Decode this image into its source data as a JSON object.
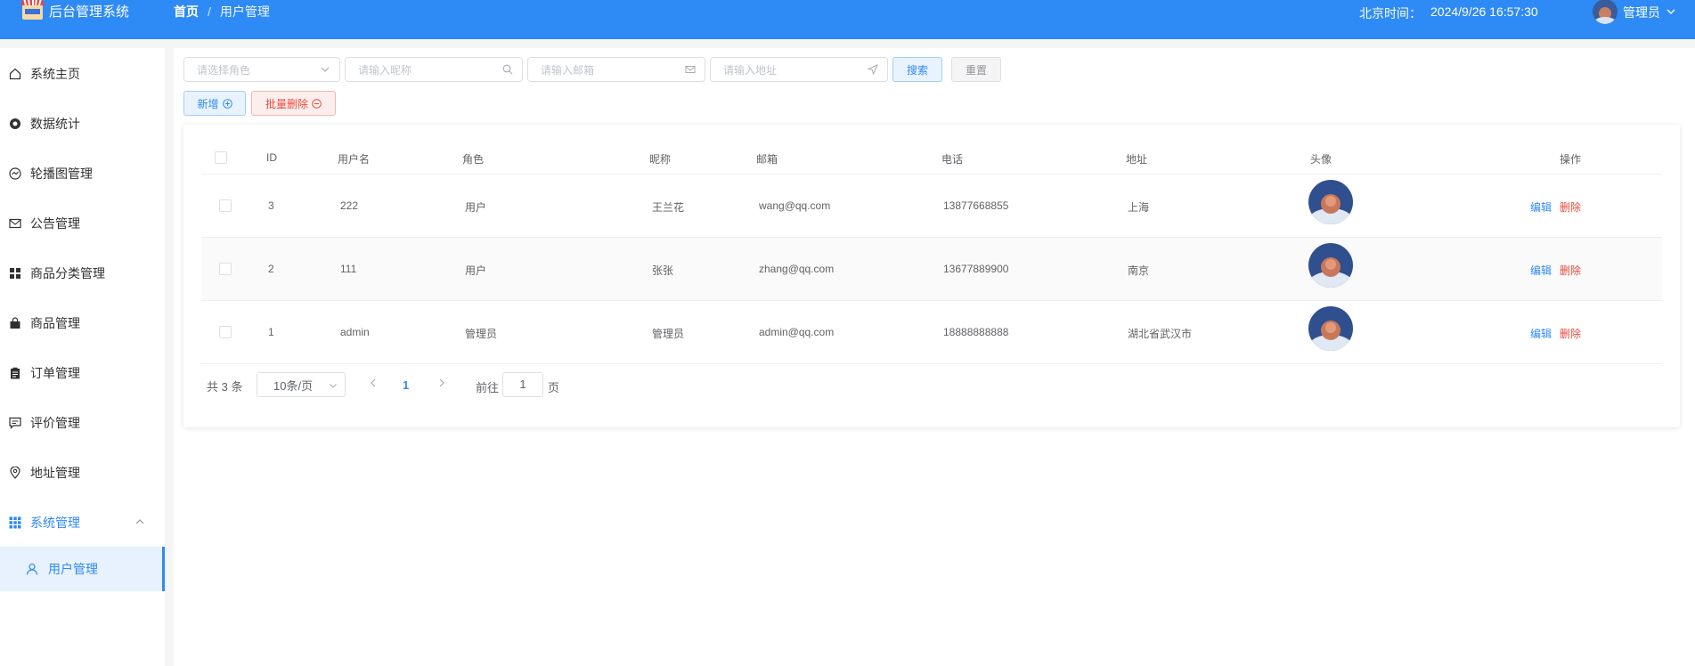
{
  "app": {
    "title": "后台管理系统"
  },
  "breadcrumb": {
    "home": "首页",
    "separator": "/",
    "current": "用户管理"
  },
  "clock": {
    "label": "北京时间：",
    "value": "2024/9/26 16:57:30"
  },
  "user": {
    "name": "管理员"
  },
  "sidebar": {
    "items": [
      {
        "label": "系统主页",
        "icon": "home-icon"
      },
      {
        "label": "数据统计",
        "icon": "stats-icon"
      },
      {
        "label": "轮播图管理",
        "icon": "carousel-icon"
      },
      {
        "label": "公告管理",
        "icon": "mail-icon"
      },
      {
        "label": "商品分类管理",
        "icon": "grid-icon"
      },
      {
        "label": "商品管理",
        "icon": "bag-icon"
      },
      {
        "label": "订单管理",
        "icon": "clipboard-icon"
      },
      {
        "label": "评价管理",
        "icon": "comment-icon"
      },
      {
        "label": "地址管理",
        "icon": "location-icon"
      },
      {
        "label": "系统管理",
        "icon": "apps-icon"
      }
    ],
    "sub_item": {
      "label": "用户管理",
      "icon": "user-icon"
    }
  },
  "filters": {
    "role_placeholder": "请选择角色",
    "nickname_placeholder": "请输入昵称",
    "email_placeholder": "请输入邮箱",
    "address_placeholder": "请输入地址",
    "search_label": "搜索",
    "reset_label": "重置"
  },
  "actions": {
    "add_label": "新增",
    "batch_delete_label": "批量删除"
  },
  "table": {
    "headers": {
      "id": "ID",
      "username": "用户名",
      "role": "角色",
      "nickname": "昵称",
      "email": "邮箱",
      "phone": "电话",
      "address": "地址",
      "avatar": "头像",
      "ops": "操作"
    },
    "rows": [
      {
        "id": "3",
        "username": "222",
        "role": "用户",
        "nickname": "王兰花",
        "email": "wang@qq.com",
        "phone": "13877668855",
        "address": "上海"
      },
      {
        "id": "2",
        "username": "111",
        "role": "用户",
        "nickname": "张张",
        "email": "zhang@qq.com",
        "phone": "13677889900",
        "address": "南京"
      },
      {
        "id": "1",
        "username": "admin",
        "role": "管理员",
        "nickname": "管理员",
        "email": "admin@qq.com",
        "phone": "18888888888",
        "address": "湖北省武汉市"
      }
    ],
    "edit_label": "编辑",
    "delete_label": "删除"
  },
  "pagination": {
    "total_text": "共 3 条",
    "page_size": "10条/页",
    "current_page": "1",
    "goto_label": "前往",
    "goto_value": "1",
    "page_unit": "页"
  },
  "colors": {
    "primary": "#2e8af5",
    "danger": "#e74c3c",
    "header_bg": "#2e8af5"
  }
}
